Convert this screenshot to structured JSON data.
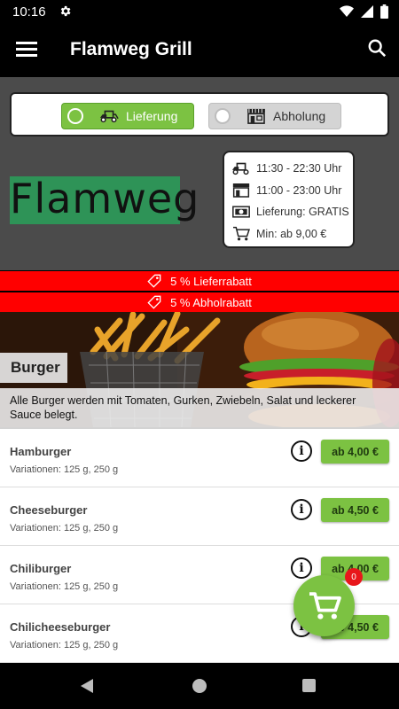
{
  "status": {
    "time": "10:16"
  },
  "app_bar": {
    "title": "Flamweg Grill"
  },
  "order_mode": {
    "delivery_label": "Lieferung",
    "pickup_label": "Abholung",
    "selected": "Lieferung"
  },
  "logo": {
    "text": "Flamweg"
  },
  "info": {
    "delivery_hours": "11:30 - 22:30 Uhr",
    "pickup_hours": "11:00 - 23:00 Uhr",
    "delivery_fee": "Lieferung: GRATIS",
    "min_order": "Min: ab 9,00 €"
  },
  "discounts": {
    "delivery": "5 % Lieferrabatt",
    "pickup": "5 % Abholrabatt"
  },
  "category": {
    "name": "Burger",
    "description": "Alle Burger werden mit Tomaten, Gurken, Zwiebeln, Salat und leckerer Sauce belegt."
  },
  "items": [
    {
      "name": "Hamburger",
      "variations": "Variationen: 125 g, 250 g",
      "price": "ab 4,00 €"
    },
    {
      "name": "Cheeseburger",
      "variations": "Variationen: 125 g, 250 g",
      "price": "ab 4,50 €"
    },
    {
      "name": "Chiliburger",
      "variations": "Variationen: 125 g, 250 g",
      "price": "ab 4,00 €"
    },
    {
      "name": "Chilicheeseburger",
      "variations": "Variationen: 125 g, 250 g",
      "price": "ab 4,50 €"
    }
  ],
  "cart": {
    "count": "0"
  },
  "colors": {
    "accent_green": "#7cc242",
    "discount_red": "#ff0000",
    "logo_green": "#2e9357",
    "badge_red": "#e8161b"
  }
}
